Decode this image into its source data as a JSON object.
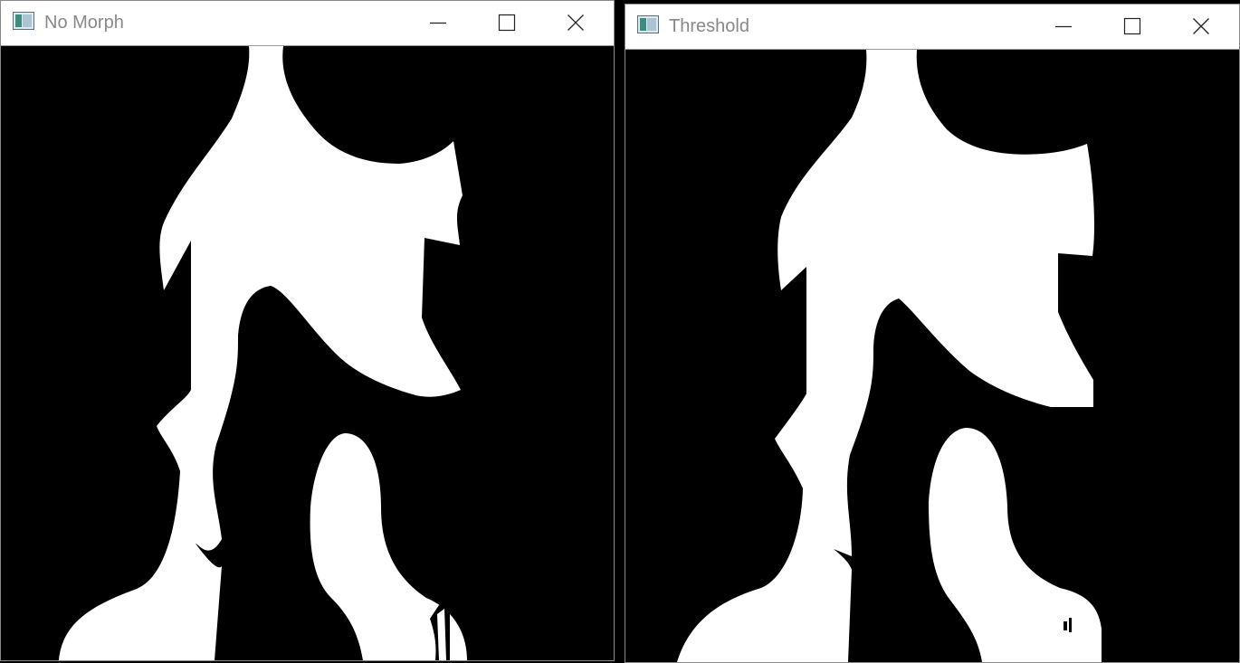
{
  "windows": [
    {
      "title": "No Morph",
      "icon": "app-window-icon",
      "controls": [
        "minimize-icon",
        "maximize-icon",
        "close-icon"
      ]
    },
    {
      "title": "Threshold",
      "icon": "app-window-icon",
      "controls": [
        "minimize-icon",
        "maximize-icon",
        "close-icon"
      ]
    }
  ],
  "colors": {
    "foreground": "#ffffff",
    "background": "#000000",
    "title_text": "#888888",
    "window_border": "#8a8a8a"
  }
}
